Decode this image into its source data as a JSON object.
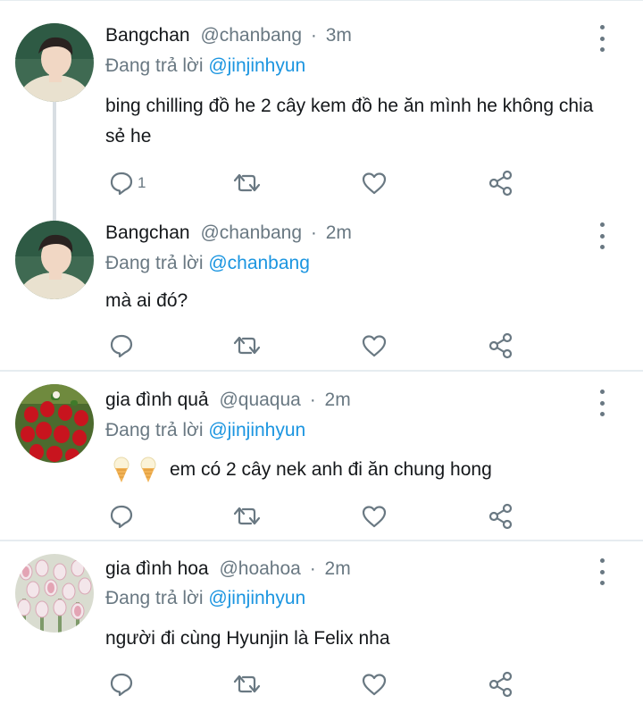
{
  "tweets": [
    {
      "name": "Bangchan",
      "handle": "@chanbang",
      "time": "3m",
      "reply_prefix": "Đang trả lời",
      "reply_to": "@jinjinhyun",
      "text": "bing chilling đồ he 2 cây kem đồ he ăn mình he không chia sẻ he",
      "reply_count": "1",
      "avatar_icon": "portrait-photo"
    },
    {
      "name": "Bangchan",
      "handle": "@chanbang",
      "time": "2m",
      "reply_prefix": "Đang trả lời",
      "reply_to": "@chanbang",
      "text": "mà ai đó?",
      "reply_count": "",
      "avatar_icon": "portrait-photo"
    },
    {
      "name": "gia đình quả",
      "handle": "@quaqua",
      "time": "2m",
      "reply_prefix": "Đang trả lời",
      "reply_to": "@jinjinhyun",
      "text": "em có 2 cây nek anh đi ăn chung hong",
      "reply_count": "",
      "avatar_icon": "strawberries-photo",
      "emojis": [
        "ice-cream-icon",
        "ice-cream-icon"
      ]
    },
    {
      "name": "gia đình hoa",
      "handle": "@hoahoa",
      "time": "2m",
      "reply_prefix": "Đang trả lời",
      "reply_to": "@jinjinhyun",
      "text": "người đi cùng Hyunjin là Felix nha",
      "reply_count": "",
      "avatar_icon": "tulips-photo"
    }
  ],
  "separator": "·",
  "colors": {
    "text": "#14171a",
    "muted": "#697882",
    "link": "#1b95e0",
    "divider": "#e6ecf0"
  }
}
